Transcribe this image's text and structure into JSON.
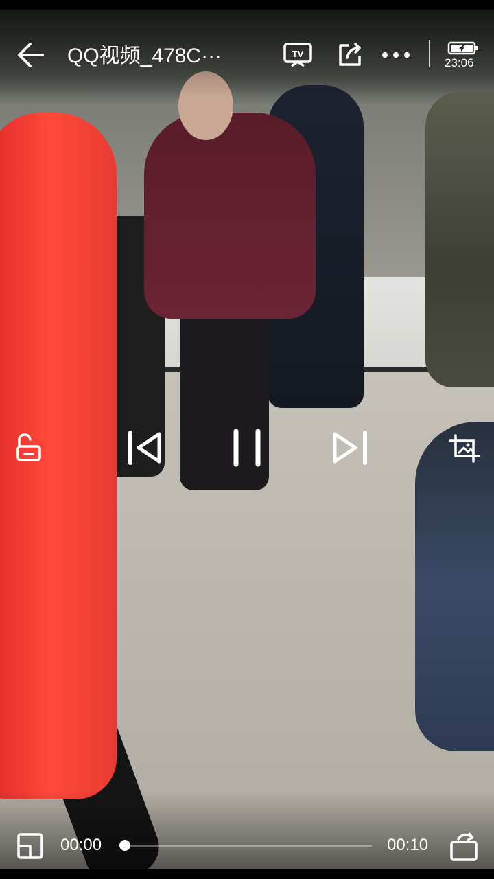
{
  "header": {
    "title": "QQ视频_478C···",
    "clock": "23:06",
    "icons": [
      "back-arrow-icon",
      "tv-cast-icon",
      "share-icon",
      "more-dots-icon",
      "battery-icon"
    ]
  },
  "controls": {
    "icons": [
      "unlock-icon",
      "previous-icon",
      "pause-icon",
      "next-icon",
      "screenshot-icon"
    ]
  },
  "footer": {
    "current_time": "00:00",
    "duration": "00:10",
    "progress": 0.0,
    "icons": [
      "small-window-icon",
      "rotate-icon"
    ]
  },
  "colors": {
    "foreground": "#ffffff"
  }
}
